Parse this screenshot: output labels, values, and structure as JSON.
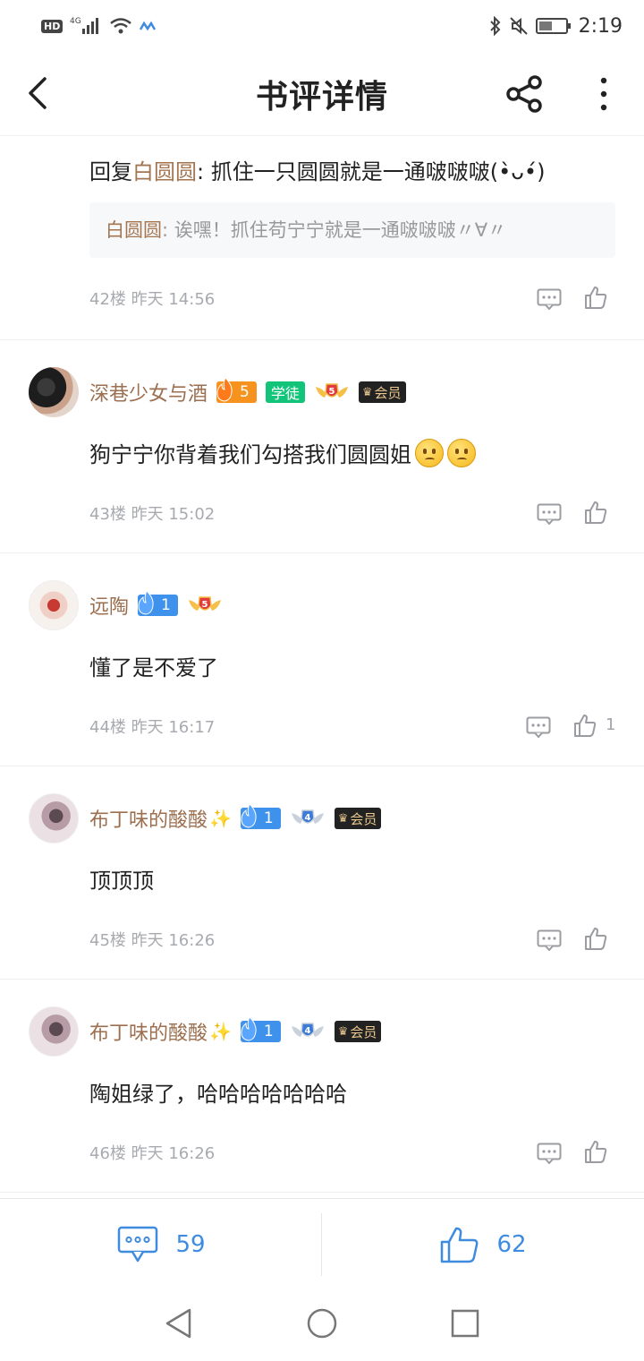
{
  "status_bar": {
    "left_badge": "HD",
    "network": "4G",
    "time": "2:19",
    "icons": [
      "signal-icon",
      "wifi-icon",
      "bluetooth-icon",
      "mute-icon",
      "battery-icon"
    ]
  },
  "nav": {
    "title": "书评详情",
    "back_icon": "back-arrow-icon",
    "share_icon": "share-icon",
    "more_icon": "more-vertical-icon"
  },
  "first_block": {
    "reply_prefix": "回复",
    "reply_target": "白圆圆",
    "reply_text": ": 抓住一只圆圆就是一通啵啵啵(•̀ᴗ•́)",
    "quote_author": "白圆圆",
    "quote_text": ": 诶嘿！抓住苟宁宁就是一通啵啵啵〃∀〃",
    "meta": "42楼 昨天 14:56"
  },
  "comments": [
    {
      "username": "深巷少女与酒",
      "fire_level": "5",
      "fire_color": "#f6921e",
      "title_badge": "学徒",
      "wing_level": "5",
      "vip_label": "会员",
      "text": "狗宁宁你背着我们勾搭我们圆圆姐",
      "emojis": 2,
      "meta": "43楼 昨天 15:02",
      "likes": ""
    },
    {
      "username": "远陶",
      "fire_level": "1",
      "fire_color": "#3e92ec",
      "wing_level": "5",
      "text": "懂了是不爱了",
      "meta": "44楼 昨天 16:17",
      "likes": "1"
    },
    {
      "username": "布丁味的酸酸",
      "sparkle": "✨",
      "fire_level": "1",
      "fire_color": "#3e92ec",
      "wing_level": "4",
      "vip_label": "会员",
      "text": "顶顶顶",
      "meta": "45楼 昨天 16:26",
      "likes": ""
    },
    {
      "username": "布丁味的酸酸",
      "sparkle": "✨",
      "fire_level": "1",
      "fire_color": "#3e92ec",
      "wing_level": "4",
      "vip_label": "会员",
      "text": "陶姐绿了，哈哈哈哈哈哈哈",
      "meta": "46楼 昨天 16:26",
      "likes": ""
    }
  ],
  "bottom_bar": {
    "comment_count": "59",
    "like_count": "62",
    "accent": "#3e8be0"
  },
  "system_nav": [
    "back-triangle-icon",
    "home-circle-icon",
    "recents-square-icon"
  ]
}
